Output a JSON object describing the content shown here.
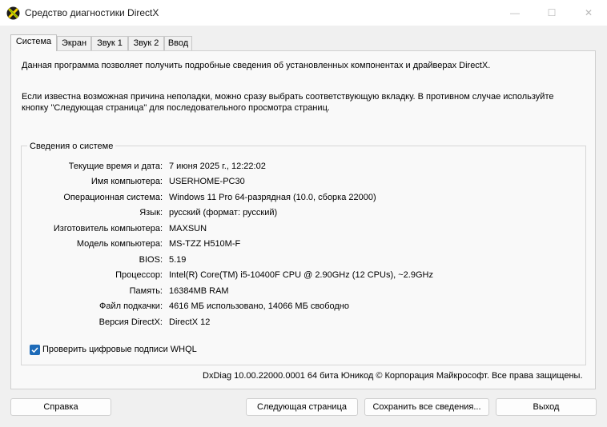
{
  "window": {
    "title": "Средство диагностики DirectX",
    "minimize_glyph": "—",
    "maximize_glyph": "☐",
    "close_glyph": "✕"
  },
  "tabs": [
    {
      "label": "Система",
      "active": true
    },
    {
      "label": "Экран",
      "active": false
    },
    {
      "label": "Звук 1",
      "active": false
    },
    {
      "label": "Звук 2",
      "active": false
    },
    {
      "label": "Ввод",
      "active": false
    }
  ],
  "intro": {
    "line1": "Данная программа позволяет получить подробные сведения об установленных компонентах и драйверах DirectX.",
    "line2": "Если известна возможная причина неполадки, можно сразу выбрать соответствующую вкладку. В противном случае используйте",
    "line3": "кнопку \"Следующая страница\" для последовательного просмотра страниц."
  },
  "system_info": {
    "title": "Сведения о системе",
    "rows": [
      {
        "label": "Текущие время и дата:",
        "value": "7 июня 2025 г., 12:22:02"
      },
      {
        "label": "Имя компьютера:",
        "value": "USERHOME-PC30"
      },
      {
        "label": "Операционная система:",
        "value": "Windows 11 Pro 64-разрядная (10.0, сборка 22000)"
      },
      {
        "label": "Язык:",
        "value": "русский (формат: русский)"
      },
      {
        "label": "Изготовитель компьютера:",
        "value": "MAXSUN"
      },
      {
        "label": "Модель компьютера:",
        "value": "MS-TZZ H510M-F"
      },
      {
        "label": "BIOS:",
        "value": "5.19"
      },
      {
        "label": "Процессор:",
        "value": "Intel(R) Core(TM) i5-10400F CPU @ 2.90GHz (12 CPUs), ~2.9GHz"
      },
      {
        "label": "Память:",
        "value": "16384MB RAM"
      },
      {
        "label": "Файл подкачки:",
        "value": "4616 МБ использовано, 14066 МБ свободно"
      },
      {
        "label": "Версия DirectX:",
        "value": "DirectX 12"
      }
    ]
  },
  "whql": {
    "label": "Проверить цифровые подписи WHQL",
    "checked": true
  },
  "footer": "DxDiag 10.00.22000.0001 64 бита Юникод © Корпорация Майкрософт. Все права защищены.",
  "buttons": {
    "help": "Справка",
    "next": "Следующая страница",
    "save": "Сохранить все сведения...",
    "exit": "Выход"
  },
  "colors": {
    "accent": "#1e6bb8",
    "window_bg": "#f0f0f0",
    "panel_bg": "#f9f9f9"
  }
}
